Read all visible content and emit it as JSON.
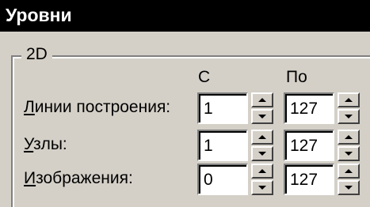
{
  "window": {
    "title": "Уровни"
  },
  "group": {
    "label": "2D"
  },
  "columns": {
    "from": "С",
    "to": "По"
  },
  "rows": [
    {
      "label_mnemonic": "Л",
      "label_rest": "инии построения:",
      "from": "1",
      "to": "127"
    },
    {
      "label_mnemonic": "У",
      "label_rest": "злы:",
      "from": "1",
      "to": "127"
    },
    {
      "label_mnemonic": "И",
      "label_rest": "зображения:",
      "from": "0",
      "to": "127"
    }
  ]
}
